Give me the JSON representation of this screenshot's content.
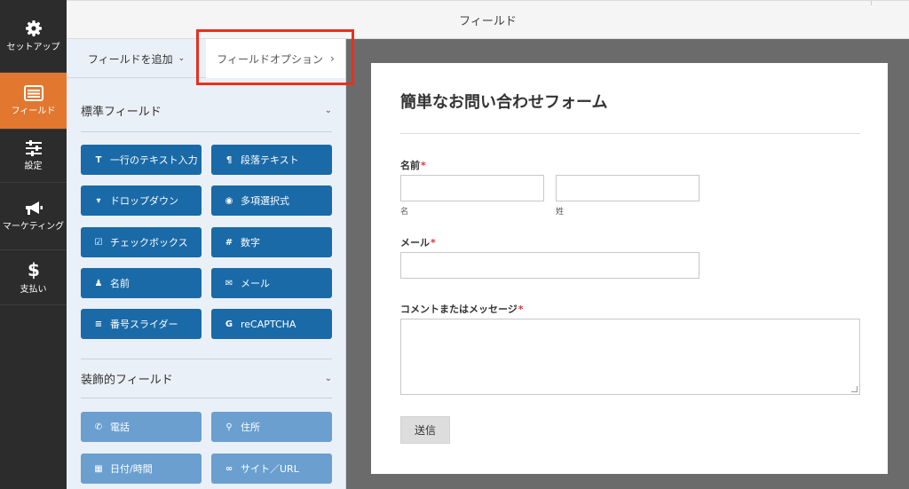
{
  "sidebar": {
    "items": [
      {
        "icon": "gear-icon",
        "label": "セットアップ"
      },
      {
        "icon": "fields-icon",
        "label": "フィールド"
      },
      {
        "icon": "sliders-icon",
        "label": "設定"
      },
      {
        "icon": "megaphone-icon",
        "label": "マーケティング"
      },
      {
        "icon": "dollar-icon",
        "label": "支払い"
      }
    ],
    "active_index": 1
  },
  "header": {
    "title": "フィールド"
  },
  "panel": {
    "tabs": {
      "add_fields": "フィールドを追加",
      "add_fields_chevron": "⌄",
      "field_options": "フィールドオプション",
      "field_options_chevron": "›"
    },
    "standard": {
      "title": "標準フィールド",
      "chevron": "⌄",
      "fields": [
        {
          "icon": "text-icon",
          "glyph": "T",
          "label": "一行のテキスト入力"
        },
        {
          "icon": "paragraph-icon",
          "glyph": "¶",
          "label": "段落テキスト"
        },
        {
          "icon": "dropdown-icon",
          "glyph": "▾",
          "label": "ドロップダウン"
        },
        {
          "icon": "radio-icon",
          "glyph": "◉",
          "label": "多項選択式"
        },
        {
          "icon": "checkbox-icon",
          "glyph": "☑",
          "label": "チェックボックス"
        },
        {
          "icon": "hash-icon",
          "glyph": "#",
          "label": "数字"
        },
        {
          "icon": "user-icon",
          "glyph": "♟",
          "label": "名前"
        },
        {
          "icon": "envelope-icon",
          "glyph": "✉",
          "label": "メール"
        },
        {
          "icon": "slider-icon",
          "glyph": "≡",
          "label": "番号スライダー"
        },
        {
          "icon": "google-icon",
          "glyph": "G",
          "label": "reCAPTCHA"
        }
      ]
    },
    "fancy": {
      "title": "装飾的フィールド",
      "chevron": "⌄",
      "fields": [
        {
          "icon": "phone-icon",
          "glyph": "✆",
          "label": "電話"
        },
        {
          "icon": "map-pin-icon",
          "glyph": "⚲",
          "label": "住所"
        },
        {
          "icon": "calendar-icon",
          "glyph": "▦",
          "label": "日付/時間"
        },
        {
          "icon": "link-icon",
          "glyph": "∞",
          "label": "サイト／URL"
        }
      ]
    }
  },
  "form": {
    "title": "簡単なお問い合わせフォーム",
    "name_label": "名前",
    "first_sublabel": "名",
    "last_sublabel": "姓",
    "email_label": "メール",
    "message_label": "コメントまたはメッセージ",
    "required_mark": "*",
    "submit": "送信"
  },
  "colors": {
    "sidebar_bg": "#2c2c2c",
    "active_orange": "#e27730",
    "standard_button": "#1a6aa8",
    "fancy_button": "#6a9fd0",
    "highlight_red": "#e8301e",
    "preview_bg": "#6b6b6b"
  }
}
